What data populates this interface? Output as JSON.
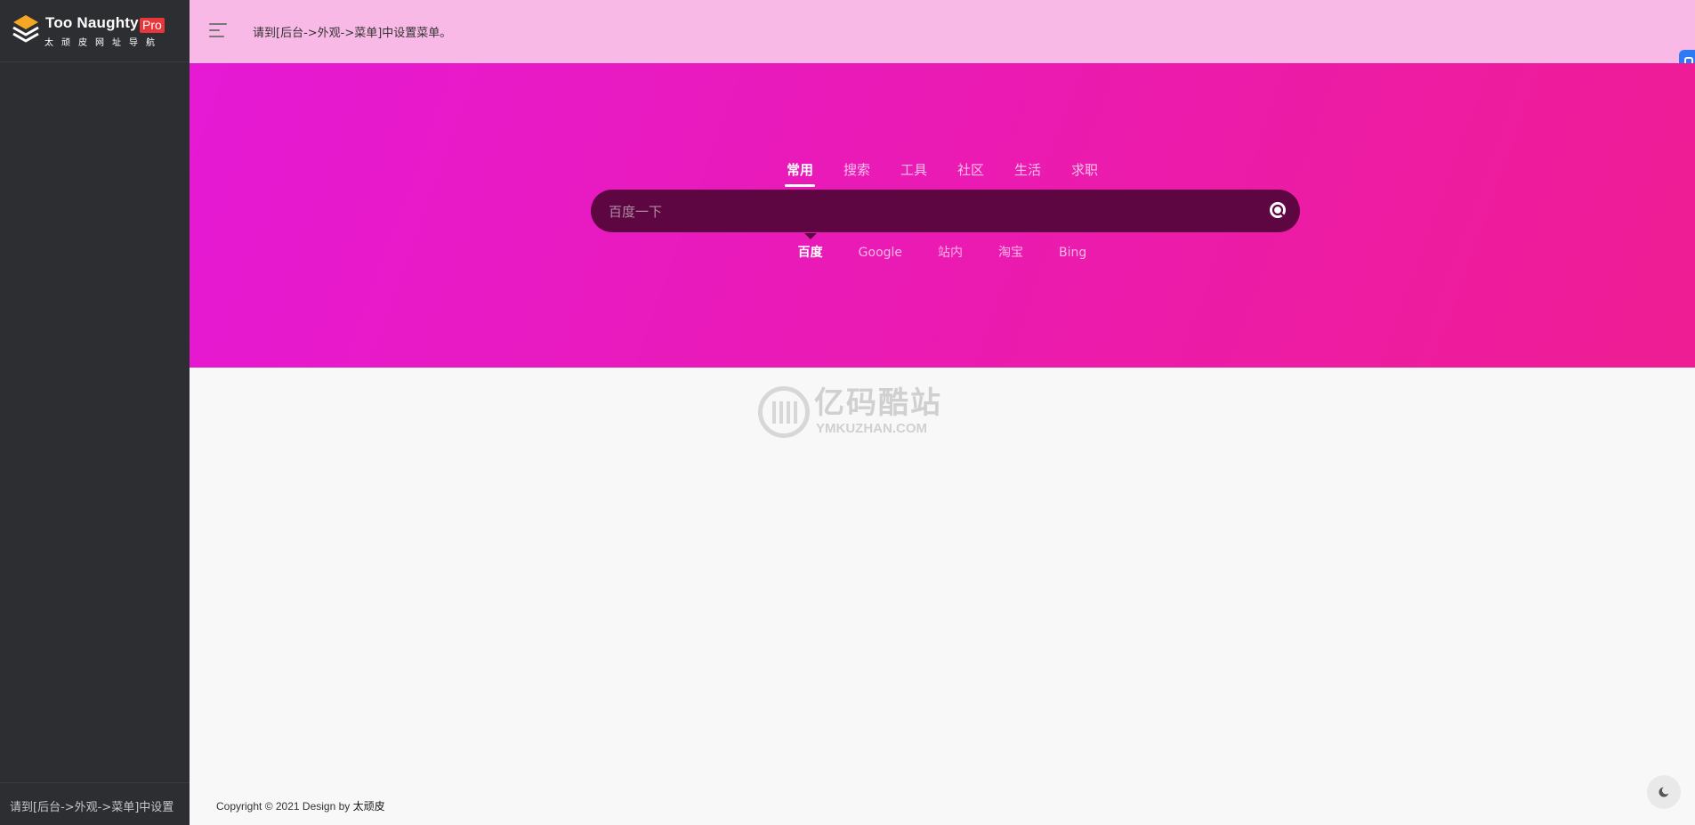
{
  "sidebar": {
    "logo": {
      "title": "Too Naughty",
      "badge": "Pro",
      "subtitle": "太顽皮网址导航"
    },
    "footer_text": "请到[后台->外观->菜单]中设置"
  },
  "header": {
    "message": "请到[后台->外观->菜单]中设置菜单。"
  },
  "search": {
    "tabs": [
      {
        "label": "常用",
        "active": true
      },
      {
        "label": "搜索",
        "active": false
      },
      {
        "label": "工具",
        "active": false
      },
      {
        "label": "社区",
        "active": false
      },
      {
        "label": "生活",
        "active": false
      },
      {
        "label": "求职",
        "active": false
      }
    ],
    "placeholder": "百度一下",
    "engines": [
      {
        "label": "百度",
        "active": true
      },
      {
        "label": "Google",
        "active": false
      },
      {
        "label": "站内",
        "active": false
      },
      {
        "label": "淘宝",
        "active": false
      },
      {
        "label": "Bing",
        "active": false
      }
    ]
  },
  "watermark": {
    "title": "亿码酷站",
    "subtitle": "YMKUZHAN.COM"
  },
  "footer": {
    "copyright": "Copyright © 2021 ",
    "design_prefix": "Design by ",
    "designer": "太顽皮"
  },
  "colors": {
    "sidebar_bg": "#2d2e31",
    "header_bg": "#f8b9e6",
    "hero_gradient_start": "#e619d5",
    "hero_gradient_end": "#ef1d93",
    "search_bg": "#5e0641",
    "logo_badge": "#e8363b"
  },
  "icons": {
    "logo": "layers-icon",
    "menu": "menu-lines-icon",
    "search": "search-icon",
    "edge_widget": "message-icon",
    "theme": "moon-icon"
  }
}
